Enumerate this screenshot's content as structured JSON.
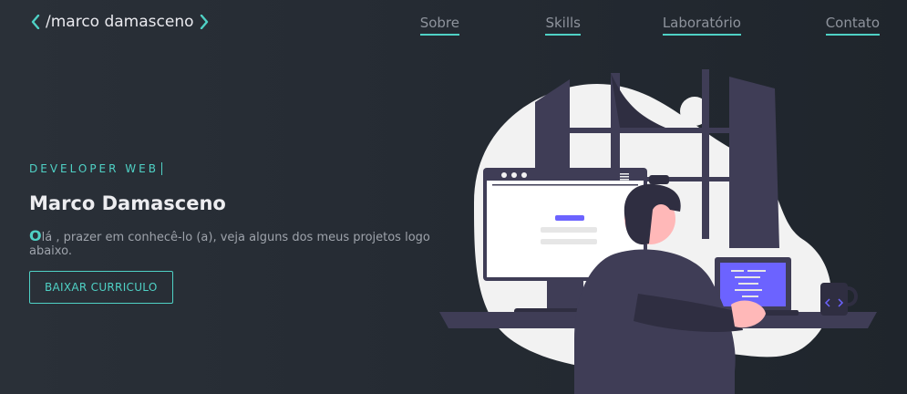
{
  "header": {
    "logo_text": "/marco damasceno",
    "nav": [
      {
        "label": "Sobre"
      },
      {
        "label": "Skills"
      },
      {
        "label": "Laboratório"
      },
      {
        "label": "Contato"
      }
    ]
  },
  "hero": {
    "eyebrow": "DEVELOPER WEB",
    "name": "Marco Damasceno",
    "intro_first_letter": "O",
    "intro_rest": "lá , prazer em conhecê-lo (a), veja alguns dos meus projetos logo abaixo.",
    "cta_label": "BAIXAR CURRICULO"
  },
  "colors": {
    "accent": "#4fd1c5",
    "background": "#252b33",
    "illustration_dark": "#3f3d56",
    "illustration_light": "#f2f2f2",
    "illustration_purple": "#6c63ff"
  }
}
